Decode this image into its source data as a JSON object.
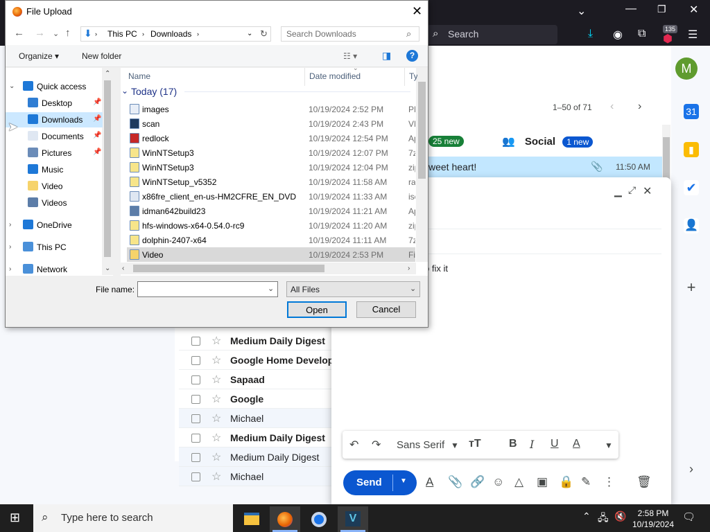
{
  "browser": {
    "search_placeholder": "Search",
    "downloads_badge": "135"
  },
  "gmail": {
    "avatar_letter": "M",
    "pager": "1–50 of 71",
    "tabs": {
      "primary_badge": "25 new",
      "social_label": "Social",
      "social_badge": "1 new"
    },
    "first_row": {
      "snippet": "weet heart!",
      "time": "11:50 AM"
    },
    "compose_body_text": "o fix it",
    "mail_rows": [
      {
        "sender": "Medium Daily Digest",
        "bold": true
      },
      {
        "sender": "Google Home Develop",
        "bold": true
      },
      {
        "sender": "Sapaad",
        "bold": true
      },
      {
        "sender": "Google",
        "bold": true
      },
      {
        "sender": "Michael",
        "bold": false
      },
      {
        "sender": "Medium Daily Digest",
        "bold": true
      },
      {
        "sender": "Medium Daily Digest",
        "bold": false
      },
      {
        "sender": "Michael",
        "bold": false
      }
    ],
    "font_select": "Sans Serif",
    "send_label": "Send"
  },
  "dialog": {
    "title": "File Upload",
    "breadcrumb": [
      "This PC",
      "Downloads"
    ],
    "search_placeholder": "Search Downloads",
    "organize_label": "Organize",
    "new_folder_label": "New folder",
    "nav": {
      "quick_access": "Quick access",
      "items": [
        "Desktop",
        "Downloads",
        "Documents",
        "Pictures",
        "Music",
        "Video",
        "Videos"
      ],
      "onedrive": "OneDrive",
      "this_pc": "This PC",
      "network": "Network"
    },
    "columns": {
      "name": "Name",
      "date": "Date modified",
      "type": "Ty"
    },
    "group_header": "Today (17)",
    "files": [
      {
        "name": "images",
        "date": "10/19/2024 2:52 PM",
        "type": "PN",
        "icon": "#e8eef7"
      },
      {
        "name": "scan",
        "date": "10/19/2024 2:43 PM",
        "type": "VE",
        "icon": "#1e3a5f"
      },
      {
        "name": "redlock",
        "date": "10/19/2024 12:54 PM",
        "type": "Ap",
        "icon": "#c62828"
      },
      {
        "name": "WinNTSetup3",
        "date": "10/19/2024 12:07 PM",
        "type": "7z",
        "icon": "#f7e58a"
      },
      {
        "name": "WinNTSetup3",
        "date": "10/19/2024 12:04 PM",
        "type": "zip",
        "icon": "#f7e58a"
      },
      {
        "name": "WinNTSetup_v5352",
        "date": "10/19/2024 11:58 AM",
        "type": "ra",
        "icon": "#f7e58a"
      },
      {
        "name": "x86fre_client_en-us-HM2CFRE_EN_DVD",
        "date": "10/19/2024 11:33 AM",
        "type": "isc",
        "icon": "#dfe7f2"
      },
      {
        "name": "idman642build23",
        "date": "10/19/2024 11:21 AM",
        "type": "Ap",
        "icon": "#5c7da8"
      },
      {
        "name": "hfs-windows-x64-0.54.0-rc9",
        "date": "10/19/2024 11:20 AM",
        "type": "zip",
        "icon": "#f7e58a"
      },
      {
        "name": "dolphin-2407-x64",
        "date": "10/19/2024 11:11 AM",
        "type": "7z",
        "icon": "#f7e58a"
      },
      {
        "name": "Video",
        "date": "10/19/2024 2:53 PM",
        "type": "Fi",
        "icon": "#f6d36b"
      }
    ],
    "file_name_label": "File name:",
    "file_name_value": "",
    "file_type": "All Files",
    "open_label": "Open",
    "cancel_label": "Cancel"
  },
  "taskbar": {
    "search_placeholder": "Type here to search",
    "time": "2:58 PM",
    "date": "10/19/2024"
  }
}
